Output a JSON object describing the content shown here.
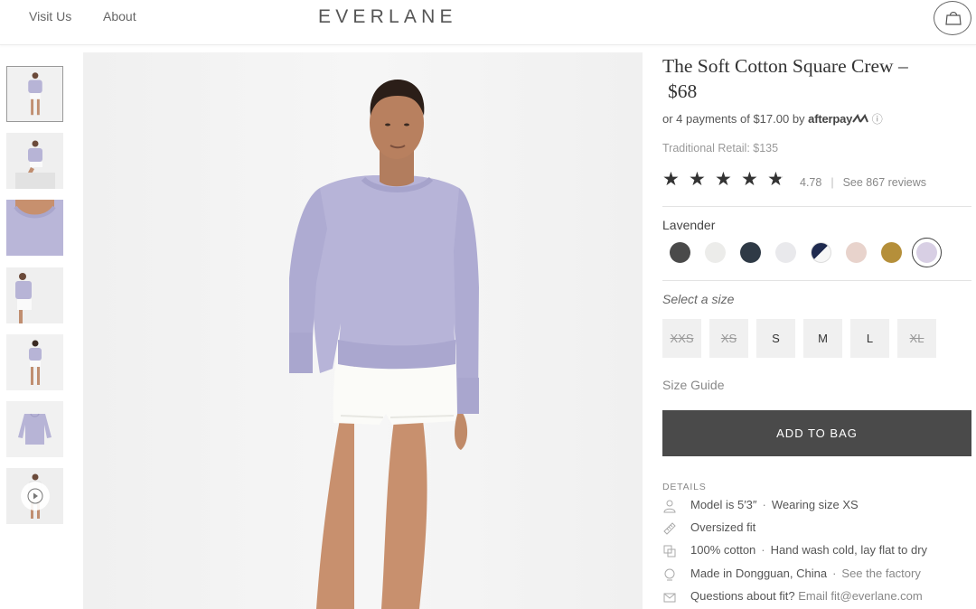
{
  "header": {
    "nav": [
      "Visit Us",
      "About"
    ],
    "logo": "EVERLANE",
    "cart_icon": "bag-icon"
  },
  "gallery": {
    "thumbnails": [
      "front-view",
      "seated-view",
      "neckline-detail",
      "side-view",
      "back-view",
      "flat-lay",
      "video"
    ],
    "active_index": 0,
    "play_icon": "play-icon"
  },
  "product": {
    "title": "The Soft Cotton Square Crew –",
    "price": "$68",
    "afterpay_prefix": "or 4 payments of $17.00 by",
    "afterpay_brand": "afterpay",
    "afterpay_info": "ⓘ",
    "traditional_retail": "Traditional Retail: $135",
    "rating": {
      "value": "4.78",
      "stars": 4.78,
      "reviews_link": "See 867 reviews"
    },
    "color": {
      "selected_name": "Lavender",
      "swatches": [
        "#4a4a4a",
        "#ececea",
        "#2f3a46",
        "#e9e9ec",
        "navy-white-split",
        "#e8d3cc",
        "#b58f3a",
        "#d8cfe4"
      ],
      "selected_index": 7
    },
    "size": {
      "label": "Select a size",
      "options": [
        {
          "label": "XXS",
          "available": false
        },
        {
          "label": "XS",
          "available": false
        },
        {
          "label": "S",
          "available": true
        },
        {
          "label": "M",
          "available": true
        },
        {
          "label": "L",
          "available": true
        },
        {
          "label": "XL",
          "available": false
        }
      ],
      "guide": "Size Guide"
    },
    "add_to_bag": "ADD TO BAG",
    "details": {
      "label": "DETAILS",
      "rows": [
        {
          "icon": "person-icon",
          "text": "Model is 5′3″",
          "extra": "Wearing size XS"
        },
        {
          "icon": "ruler-icon",
          "text": "Oversized fit",
          "extra": ""
        },
        {
          "icon": "fabric-icon",
          "text": "100% cotton",
          "extra": "Hand wash cold, lay flat to dry"
        },
        {
          "icon": "globe-icon",
          "text": "Made in Dongguan, China",
          "extra": "See the factory"
        },
        {
          "icon": "mail-icon",
          "text": "Questions about fit?",
          "extra": "Email fit@everlane.com"
        }
      ]
    }
  }
}
